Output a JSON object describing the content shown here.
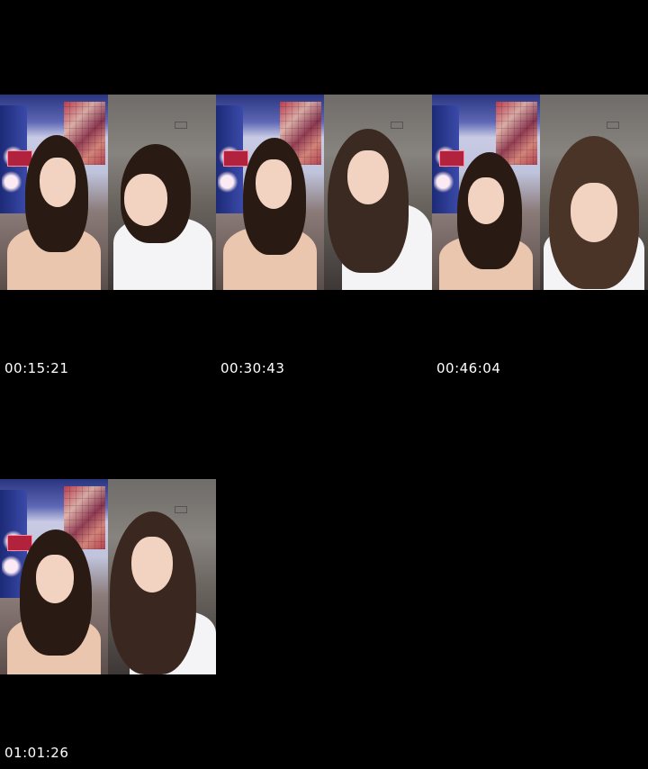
{
  "thumbnails": [
    {
      "timestamp": "00:15:21"
    },
    {
      "timestamp": "00:30:43"
    },
    {
      "timestamp": "00:46:04"
    },
    {
      "timestamp": "01:01:26"
    }
  ]
}
